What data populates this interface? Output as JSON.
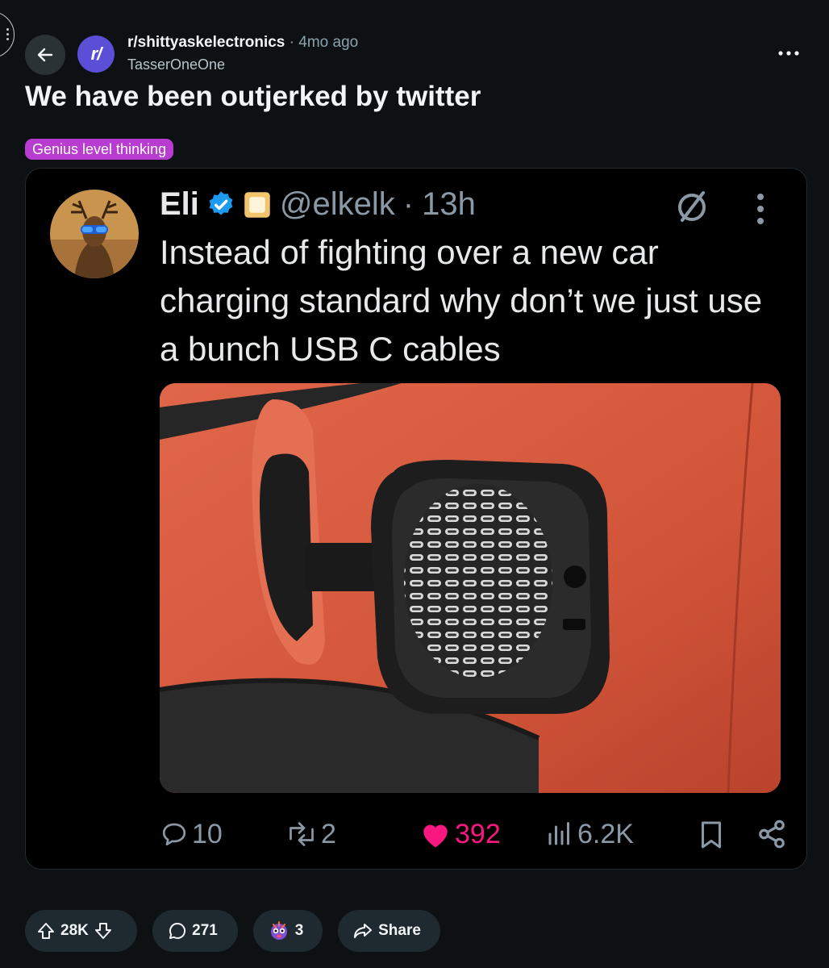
{
  "header": {
    "subreddit": "r/shittyaskelectronics",
    "separator": "·",
    "time_ago": "4mo ago",
    "author": "TasserOneOne",
    "subreddit_icon_text": "r/"
  },
  "post": {
    "title": "We have been outjerked by twitter",
    "flair": "Genius level thinking"
  },
  "tweet": {
    "display_name": "Eli",
    "handle": "@elkelk",
    "separator": "·",
    "time": "13h",
    "text": "Instead of fighting over a new car charging standard why don’t we just use a bunch  USB C cables",
    "actions": {
      "replies": "10",
      "retweets": "2",
      "likes": "392",
      "views": "6.2K"
    },
    "colors": {
      "like": "#f91880",
      "verified": "#1d9bf0",
      "muted": "#8b98a5"
    }
  },
  "actions_bar": {
    "upvotes": "28K",
    "comments": "271",
    "awards": "3",
    "share_label": "Share"
  },
  "icons": [
    "back-arrow-icon",
    "more-horizontal-icon",
    "verified-badge-icon",
    "affiliate-badge-icon",
    "no-follow-icon",
    "kebab-vertical-icon",
    "reply-icon",
    "retweet-icon",
    "heart-icon",
    "views-icon",
    "bookmark-icon",
    "share-nodes-icon",
    "upvote-icon",
    "downvote-icon",
    "comment-icon",
    "award-icon",
    "share-arrow-icon"
  ],
  "colors": {
    "background": "#0e1113",
    "flair": "#b93cd1",
    "pill": "#1f2a30",
    "accent": "#5a4fd6"
  }
}
